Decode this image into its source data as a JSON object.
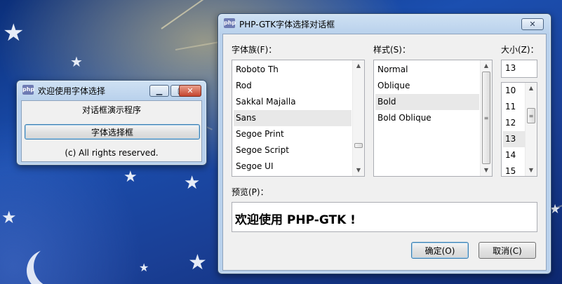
{
  "main_window": {
    "title": "欢迎使用字体选择",
    "icon": "php-app-icon",
    "minimize_glyph": "▁",
    "maximize_glyph": "▢",
    "close_glyph": "✕",
    "heading": "对话框演示程序",
    "button_label": "字体选择框",
    "footer": "(c) All rights reserved."
  },
  "font_dialog": {
    "title": "PHP-GTK字体选择对话框",
    "icon": "php-app-icon",
    "close_glyph": "✕",
    "family": {
      "label": "字体族(F)：",
      "items": [
        "Roboto Th",
        "Rod",
        "Sakkal Majalla",
        "Sans",
        "Segoe Print",
        "Segoe Script",
        "Segoe UI"
      ],
      "selected": "Sans"
    },
    "style": {
      "label": "样式(S)：",
      "items": [
        "Normal",
        "Oblique",
        "Bold",
        "Bold Oblique"
      ],
      "selected": "Bold"
    },
    "size": {
      "label": "大小(Z)：",
      "value": "13",
      "items": [
        "10",
        "11",
        "12",
        "13",
        "14",
        "15"
      ],
      "selected": "13"
    },
    "preview": {
      "label": "预览(P)：",
      "text": "欢迎使用 PHP-GTK !"
    },
    "ok_label": "确定(O)",
    "cancel_label": "取消(C)"
  },
  "colors": {
    "desktop": "#1b4fb0",
    "window_frame": "#b9d1ec",
    "client": "#f0f0f0",
    "selection": "#e8e8e8",
    "close_button": "#c5452e"
  }
}
